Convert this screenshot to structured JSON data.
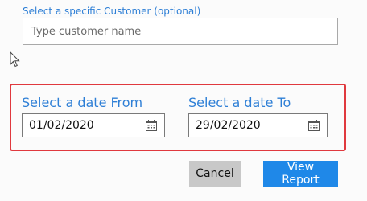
{
  "customer": {
    "label": "Select a specific Customer (optional)",
    "placeholder": "Type customer name",
    "value": ""
  },
  "date_from": {
    "label": "Select a date From",
    "value": "01/02/2020",
    "icon": "calendar-icon"
  },
  "date_to": {
    "label": "Select a date To",
    "value": "29/02/2020",
    "icon": "calendar-icon"
  },
  "buttons": {
    "cancel": "Cancel",
    "view_report": "View Report"
  },
  "colors": {
    "accent": "#2e7fd6",
    "highlight_border": "#e0393e",
    "primary_button": "#1f88e8",
    "secondary_button": "#c8c8c8"
  }
}
